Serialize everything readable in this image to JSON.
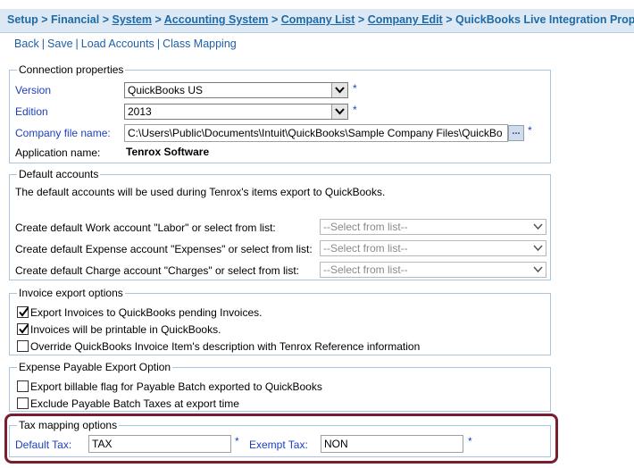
{
  "breadcrumb": {
    "setup": "Setup",
    "financial": "Financial",
    "system": "System",
    "accounting_system": "Accounting System",
    "company_list": "Company List",
    "company_edit": "Company Edit",
    "current": "QuickBooks Live Integration Properties",
    "separator": ">"
  },
  "actions": {
    "back": "Back",
    "save": "Save",
    "load_accounts": "Load Accounts",
    "class_mapping": "Class Mapping",
    "separator": "|"
  },
  "connection": {
    "legend": "Connection properties",
    "version_label": "Version",
    "version_value": "QuickBooks US",
    "edition_label": "Edition",
    "edition_value": "2013",
    "company_file_label": "Company file name:",
    "company_file_value": "C:\\Users\\Public\\Documents\\Intuit\\QuickBooks\\Sample Company Files\\QuickBo",
    "browse_label": "...",
    "app_name_label": "Application name:",
    "app_name_value": "Tenrox Software",
    "required_mark": "*"
  },
  "default_accounts": {
    "legend": "Default accounts",
    "description": "The default accounts will be used during Tenrox's items export to QuickBooks.",
    "work_label": "Create default Work account \"Labor\" or select from list:",
    "expense_label": "Create default Expense account \"Expenses\" or select from list:",
    "charge_label": "Create default Charge account \"Charges\" or select from list:",
    "select_placeholder": "--Select from list--"
  },
  "invoice": {
    "legend": "Invoice export options",
    "items": [
      {
        "label": "Export Invoices to QuickBooks pending Invoices.",
        "checked": true
      },
      {
        "label": "Invoices will be printable in QuickBooks.",
        "checked": true
      },
      {
        "label": "Override QuickBooks Invoice Item's description with Tenrox Reference information",
        "checked": false
      }
    ]
  },
  "expense": {
    "legend": "Expense Payable Export Option",
    "items": [
      {
        "label": "Export billable flag for Payable Batch exported to QuickBooks",
        "checked": false
      },
      {
        "label": "Exclude Payable Batch Taxes at export time",
        "checked": false
      }
    ]
  },
  "tax": {
    "legend": "Tax mapping options",
    "default_label": "Default Tax:",
    "default_value": "TAX",
    "exempt_label": "Exempt Tax:",
    "exempt_value": "NON",
    "required_mark": "*"
  },
  "colors": {
    "link_blue": "#1f5fa8",
    "label_blue": "#1c3fbf",
    "header_bg": "#dce9f5",
    "highlight": "#7a1e2e"
  }
}
